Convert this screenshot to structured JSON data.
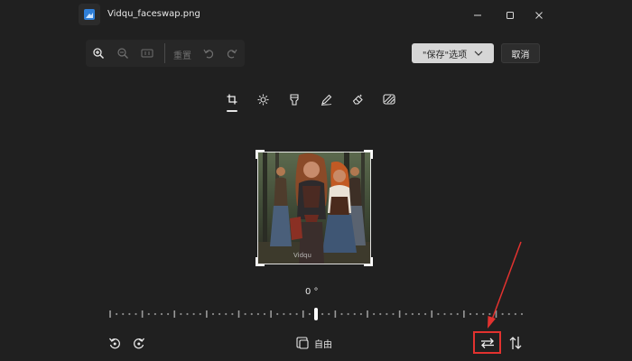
{
  "window": {
    "title": "Vidqu_faceswap.png"
  },
  "toolbar": {
    "reset_label": "重置",
    "save_options_label": "\"保存\"选项",
    "cancel_label": "取消"
  },
  "photo": {
    "watermark": "Vidqu"
  },
  "rotation": {
    "angle_label": "0 °",
    "value": 0,
    "min": -45,
    "max": 45
  },
  "bottom": {
    "aspect_label": "自由"
  },
  "colors": {
    "background": "#202020",
    "accent": "#e2322f"
  },
  "icons": {
    "title": [
      "photos-app-icon",
      "minimize-icon",
      "maximize-icon",
      "close-icon"
    ],
    "toolbar": [
      "zoom-in-icon",
      "zoom-out-icon",
      "actual-size-icon",
      "undo-icon",
      "redo-icon",
      "chevron-down-icon"
    ],
    "tabs": [
      "crop-icon",
      "brightness-icon",
      "filter-icon",
      "markup-icon",
      "erase-icon",
      "background-icon"
    ],
    "bottom": [
      "rotate-left-icon",
      "rotate-right-icon",
      "aspect-ratio-icon",
      "flip-horizontal-icon",
      "flip-vertical-icon"
    ]
  }
}
